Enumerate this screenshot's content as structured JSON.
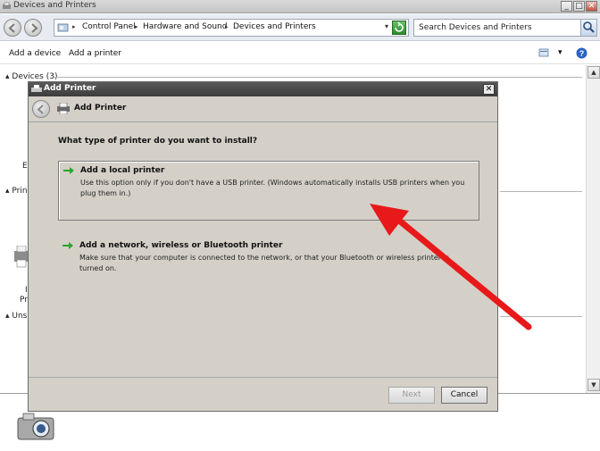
{
  "window": {
    "title": "Devices and Printers",
    "controls": {
      "minimize": "_",
      "maximize": "□",
      "close": "✕"
    }
  },
  "navigation": {
    "breadcrumbs": [
      "Control Panel",
      "Hardware and Sound",
      "Devices and Printers"
    ],
    "search_placeholder": "Search Devices and Printers"
  },
  "command_bar": {
    "items": [
      "Add a device",
      "Add a printer"
    ]
  },
  "groups": {
    "devices": "Devices (3)",
    "printers_partial": "Prin",
    "unspecified_partial": "Uns",
    "letter_e": "E",
    "letter_i": "I",
    "letter_pr": "Pr"
  },
  "dialog": {
    "title": "Add Printer",
    "header_title": "Add Printer",
    "close_label": "✕",
    "question": "What type of printer do you want to install?",
    "options": [
      {
        "title": "Add a local printer",
        "description": "Use this option only if you don't have a USB printer. (Windows automatically installs USB printers when you plug them in.)"
      },
      {
        "title": "Add a network, wireless or Bluetooth printer",
        "description": "Make sure that your computer is connected to the network, or that your Bluetooth or wireless printer is turned on."
      }
    ],
    "buttons": {
      "next": "Next",
      "cancel": "Cancel"
    }
  },
  "colors": {
    "dialog_bg": "#d4d0c8",
    "title_bar": "#4a4a4a",
    "annotation_arrow": "#e8191a",
    "option_arrow": "#2aa52a"
  }
}
